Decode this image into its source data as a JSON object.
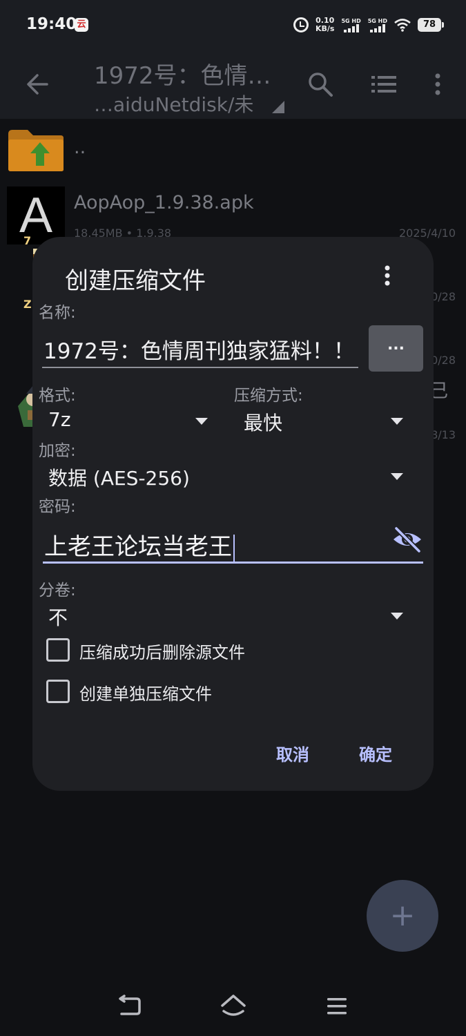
{
  "status_bar": {
    "time": "19:40",
    "app_icon_glyph": "云",
    "net_speed_value": "0.10",
    "net_speed_unit": "KB/s",
    "signal_1_label": "5G HD",
    "signal_2_label": "5G HD",
    "battery": "78"
  },
  "toolbar": {
    "title": "1972号：色情…",
    "path": "…aiduNetdisk/未"
  },
  "file_list": [
    {
      "name": "..",
      "meta": "",
      "date": ""
    },
    {
      "name": "AopAop_1.9.38.apk",
      "meta": "18.45MB  • 1.9.38",
      "date": "2025/4/10"
    },
    {
      "name": "",
      "meta": "",
      "date": "0/28",
      "badge": "7"
    },
    {
      "name": "",
      "meta": "",
      "date": "0/28",
      "badge": "Z"
    },
    {
      "name": "己",
      "meta": "",
      "date": "8/13"
    }
  ],
  "dialog": {
    "title": "创建压缩文件",
    "name_label": "名称:",
    "name_value": "1972号：色情周刊独家猛料！！",
    "browse_label": "...",
    "format_label": "格式:",
    "format_value": "7z",
    "method_label": "压缩方式:",
    "method_value": "最快",
    "encrypt_label": "加密:",
    "encrypt_value": "数据 (AES-256)",
    "password_label": "密码:",
    "password_value": "上老王论坛当老王",
    "split_label": "分卷:",
    "split_value": "不",
    "checkbox_delete_label": "压缩成功后删除源文件",
    "checkbox_separate_label": "创建单独压缩文件",
    "cancel_label": "取消",
    "ok_label": "确定"
  },
  "fab_label": "+",
  "colors": {
    "accent": "#b8c0ff",
    "dialog_bg": "#1f2024",
    "toolbar_bg": "#1b1d22",
    "folder": "#d98a1e",
    "folder_arrow": "#3f8f2e"
  }
}
